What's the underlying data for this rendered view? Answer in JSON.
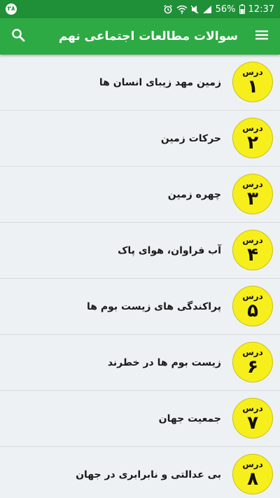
{
  "status_bar": {
    "notification_badge": "۲۸",
    "battery_percent": "56%",
    "time": "12:37"
  },
  "app_bar": {
    "title": "سوالات مطالعات اجتماعی نهم",
    "menu_icon": "hamburger-menu-icon",
    "search_icon": "search-icon"
  },
  "colors": {
    "status_bar": "#1f8f38",
    "app_bar": "#2eaa44",
    "badge_fill": "#f7ef1c",
    "list_background": "#eef1f3"
  },
  "lessons": [
    {
      "badge_label": "درس",
      "number": "۱",
      "title": "زمین مهد زیبای انسان ها"
    },
    {
      "badge_label": "درس",
      "number": "۲",
      "title": "حرکات زمین"
    },
    {
      "badge_label": "درس",
      "number": "۳",
      "title": "چهره زمین"
    },
    {
      "badge_label": "درس",
      "number": "۴",
      "title": "آب فراوان، هوای پاک"
    },
    {
      "badge_label": "درس",
      "number": "۵",
      "title": "پراکندگی های زیست بوم ها"
    },
    {
      "badge_label": "درس",
      "number": "۶",
      "title": "زیست بوم ها در خطرند"
    },
    {
      "badge_label": "درس",
      "number": "۷",
      "title": "جمعیت جهان"
    },
    {
      "badge_label": "درس",
      "number": "۸",
      "title": "بی عدالتی و نابرابری در جهان"
    }
  ]
}
